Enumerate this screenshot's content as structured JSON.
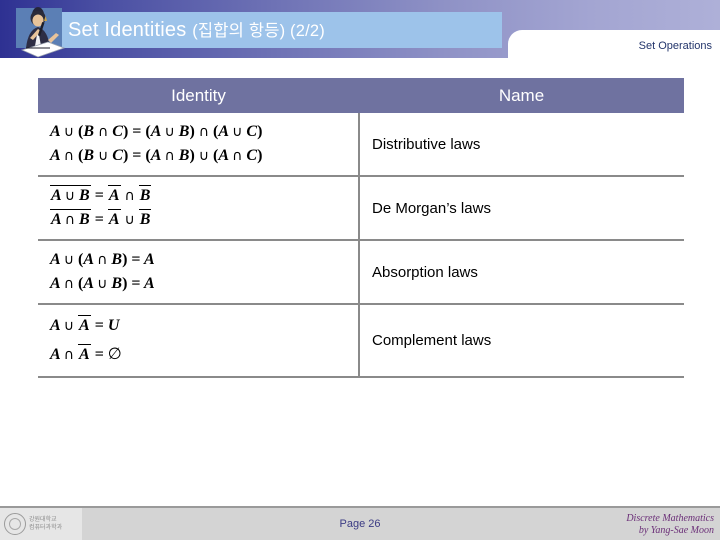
{
  "header": {
    "title_main": "Set Identities",
    "title_sub": "(집합의 항등) (2/2)",
    "icon": "student-writing-icon",
    "tab_label": "Set Operations",
    "band_color_left": "#2e3192",
    "band_color_right": "#aeb0d8",
    "title_plate_color": "#9dc3ea",
    "tab_text_color": "#23356b"
  },
  "table": {
    "header_bg": "#6f72a0",
    "header_text_color": "#ffffff",
    "columns": [
      "Identity",
      "Name"
    ],
    "rows": [
      {
        "name": "Distributive laws",
        "lines": [
          "A ∪ (B ∩ C) = (A ∪ B) ∩ (A ∪ C)",
          "A ∩ (B ∪ C) = (A ∩ B) ∪ (A ∩ C)"
        ]
      },
      {
        "name": "De Morgan’s laws",
        "lines": [
          "A ∪ B = A ∩ B",
          "A ∩ B = A ∪ B"
        ]
      },
      {
        "name": "Absorption laws",
        "lines": [
          "A ∪ (A ∩ B) = A",
          "A ∩ (A ∪ B) = A"
        ]
      },
      {
        "name": "Complement laws",
        "lines": [
          "A ∪ A = U",
          "A ∩ A = ∅"
        ]
      }
    ]
  },
  "footer": {
    "page_label": "Page 26",
    "credit_line1": "Discrete Mathematics",
    "credit_line2": "by Yang-Sae Moon",
    "logo_line1": "강원대학교",
    "logo_line2": "컴퓨터과학과",
    "bar_color": "#d4d4d4",
    "page_text_color": "#3b3b84",
    "credit_text_color": "#6b2f78"
  }
}
